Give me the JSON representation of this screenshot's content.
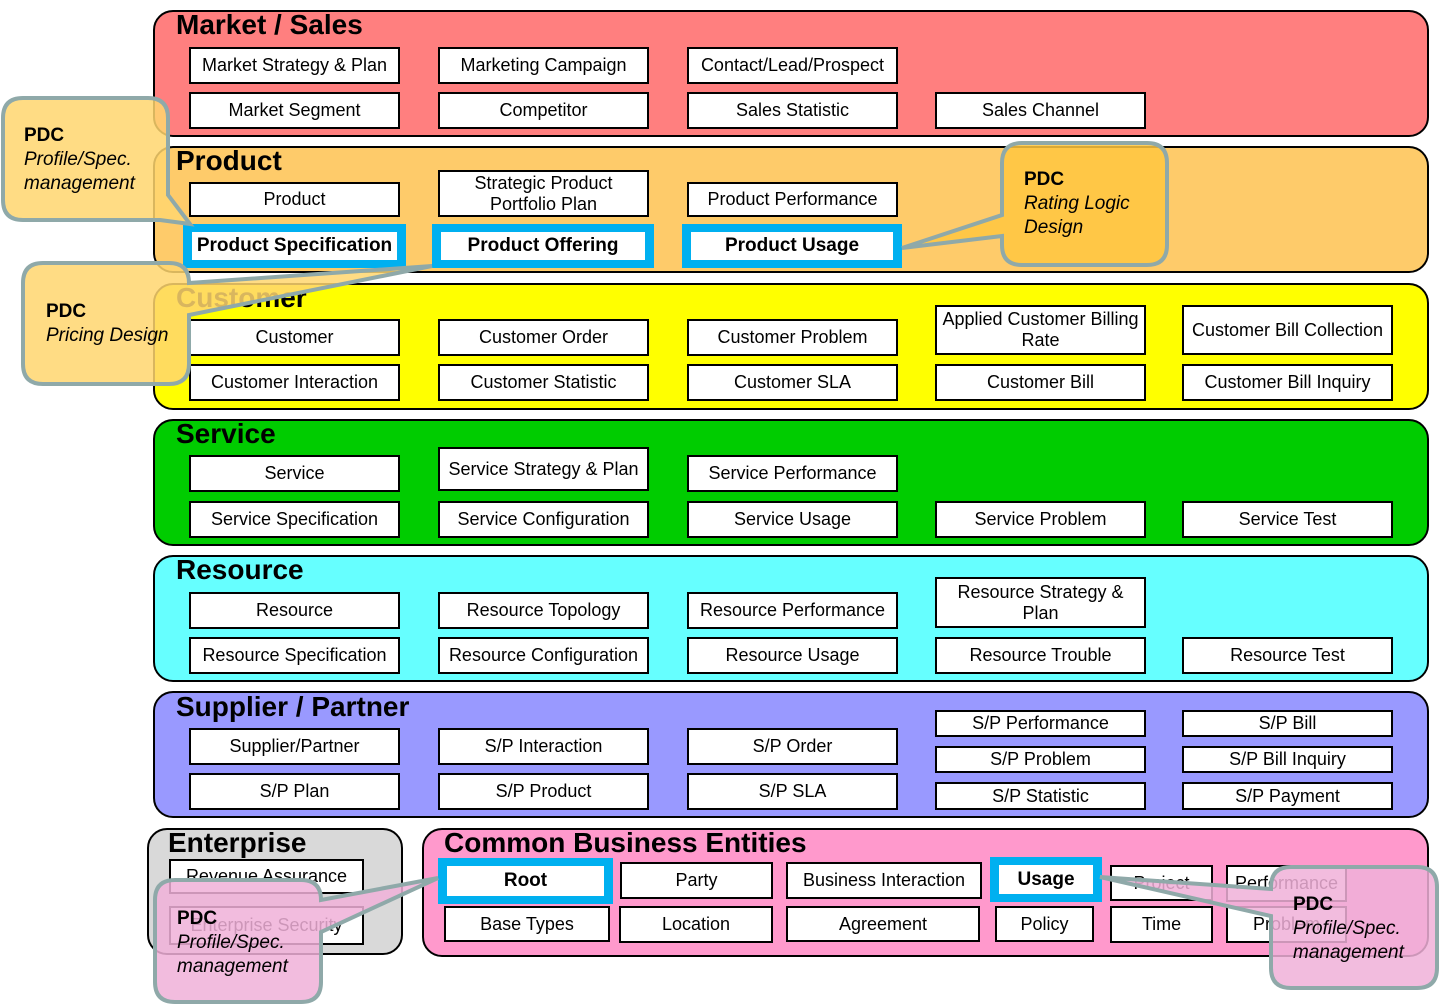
{
  "layers": [
    {
      "title": "Market / Sales",
      "color": "#ff7f7f",
      "items": [
        {
          "label": "Market Strategy & Plan"
        },
        {
          "label": "Marketing Campaign"
        },
        {
          "label": "Contact/Lead/Prospect"
        },
        {
          "label": "Market Segment"
        },
        {
          "label": "Competitor"
        },
        {
          "label": "Sales Statistic"
        },
        {
          "label": "Sales Channel"
        }
      ]
    },
    {
      "title": "Product",
      "color": "#fecb6a",
      "items": [
        {
          "label": "Product"
        },
        {
          "label": "Strategic Product Portfolio Plan"
        },
        {
          "label": "Product Performance"
        },
        {
          "label": "Product Specification",
          "highlighted": true
        },
        {
          "label": "Product Offering",
          "highlighted": true
        },
        {
          "label": "Product Usage",
          "highlighted": true
        }
      ]
    },
    {
      "title": "Customer",
      "color": "#ffff00",
      "items": [
        {
          "label": "Customer"
        },
        {
          "label": "Customer Order"
        },
        {
          "label": "Customer Problem"
        },
        {
          "label": "Applied Customer Billing Rate"
        },
        {
          "label": "Customer Bill Collection"
        },
        {
          "label": "Customer Interaction"
        },
        {
          "label": "Customer Statistic"
        },
        {
          "label": "Customer SLA"
        },
        {
          "label": "Customer Bill"
        },
        {
          "label": "Customer Bill Inquiry"
        }
      ]
    },
    {
      "title": "Service",
      "color": "#00cc00",
      "items": [
        {
          "label": "Service"
        },
        {
          "label": "Service Strategy & Plan"
        },
        {
          "label": "Service Performance"
        },
        {
          "label": "Service Specification"
        },
        {
          "label": "Service Configuration"
        },
        {
          "label": "Service Usage"
        },
        {
          "label": "Service Problem"
        },
        {
          "label": "Service Test"
        }
      ]
    },
    {
      "title": "Resource",
      "color": "#66ffff",
      "items": [
        {
          "label": "Resource"
        },
        {
          "label": "Resource Topology"
        },
        {
          "label": "Resource Performance"
        },
        {
          "label": "Resource Strategy & Plan"
        },
        {
          "label": "Resource Specification"
        },
        {
          "label": "Resource Configuration"
        },
        {
          "label": "Resource Usage"
        },
        {
          "label": "Resource Trouble"
        },
        {
          "label": "Resource Test"
        }
      ]
    },
    {
      "title": "Supplier / Partner",
      "color": "#9999ff",
      "items": [
        {
          "label": "Supplier/Partner"
        },
        {
          "label": "S/P Interaction"
        },
        {
          "label": "S/P Order"
        },
        {
          "label": "S/P Performance"
        },
        {
          "label": "S/P Bill"
        },
        {
          "label": "S/P Plan"
        },
        {
          "label": "S/P Product"
        },
        {
          "label": "S/P SLA"
        },
        {
          "label": "S/P Problem"
        },
        {
          "label": "S/P Bill Inquiry"
        },
        {
          "label": "S/P Statistic"
        },
        {
          "label": "S/P Payment"
        }
      ]
    },
    {
      "title": "Enterprise",
      "color": "#d9d9d9",
      "items": [
        {
          "label": "Revenue Assurance"
        },
        {
          "label": "Enterprise Security"
        }
      ]
    },
    {
      "title": "Common Business Entities",
      "color": "#ff99cc",
      "items": [
        {
          "label": "Root",
          "highlighted": true
        },
        {
          "label": "Party"
        },
        {
          "label": "Business Interaction"
        },
        {
          "label": "Usage",
          "highlighted": true
        },
        {
          "label": "Project"
        },
        {
          "label": "Performance"
        },
        {
          "label": "Base Types"
        },
        {
          "label": "Location"
        },
        {
          "label": "Agreement"
        },
        {
          "label": "Policy"
        },
        {
          "label": "Time"
        },
        {
          "label": "Problem"
        }
      ]
    }
  ],
  "callouts": [
    {
      "title": "PDC",
      "subtitle": "Profile/Spec.",
      "subtitle2": "management",
      "color": "#ffd66e"
    },
    {
      "title": "PDC",
      "subtitle": "Pricing Design",
      "subtitle2": "",
      "color": "#ffd66e"
    },
    {
      "title": "PDC",
      "subtitle": "Rating Logic",
      "subtitle2": "Design",
      "color": "#ffc740"
    },
    {
      "title": "PDC",
      "subtitle": "Profile/Spec.",
      "subtitle2": "management",
      "color": "#f0b0d8"
    },
    {
      "title": "PDC",
      "subtitle": "Profile/Spec.",
      "subtitle2": "management",
      "color": "#f0b0d8"
    }
  ],
  "highlight_color": "#00b0f0",
  "callout_border_color": "#8fa9a9"
}
